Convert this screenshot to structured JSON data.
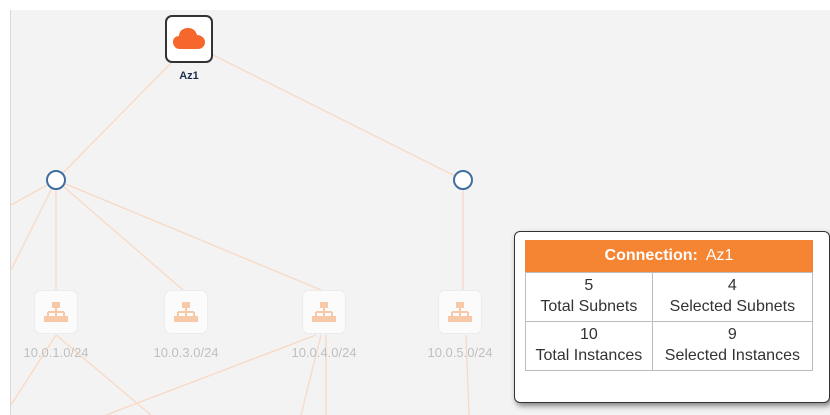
{
  "topology": {
    "availability_zone": {
      "label": "Az1",
      "icon": "cloud-icon",
      "icon_color": "#f5672c"
    },
    "vpc_nodes": [
      {
        "name": "vpc-node-left"
      },
      {
        "name": "vpc-node-right"
      }
    ],
    "subnets": [
      {
        "label": "10.0.1.0/24",
        "icon": "network-icon"
      },
      {
        "label": "10.0.3.0/24",
        "icon": "network-icon"
      },
      {
        "label": "10.0.4.0/24",
        "icon": "network-icon"
      },
      {
        "label": "10.0.5.0/24",
        "icon": "network-icon"
      }
    ],
    "link_color": "#f9d9c4",
    "node_border_color": "#3f6e9e"
  },
  "connection_popup": {
    "title_key": "Connection:",
    "title_value": "Az1",
    "header_color": "#f58533",
    "total_subnets": {
      "value": "5",
      "label": "Total Subnets"
    },
    "selected_subnets": {
      "value": "4",
      "label": "Selected Subnets"
    },
    "total_instances": {
      "value": "10",
      "label": "Total Instances"
    },
    "selected_instances": {
      "value": "9",
      "label": "Selected Instances"
    }
  }
}
